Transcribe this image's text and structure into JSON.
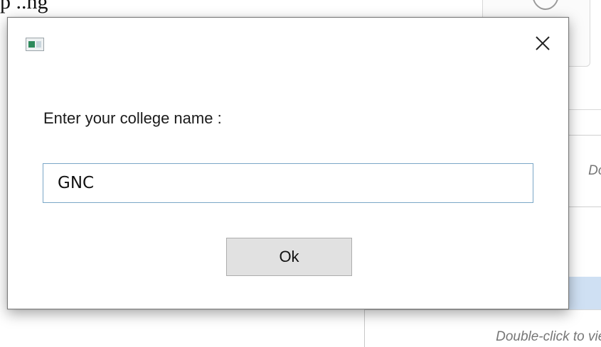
{
  "background": {
    "heading_fragment": "p   ..ng",
    "panel_text": "Double-click to view",
    "bottom_text": "Double-click to view"
  },
  "dialog": {
    "title": "",
    "app_icon": "window-app-icon",
    "close_icon": "close-icon",
    "prompt_label": "Enter your college name :",
    "input_value": "GNC",
    "ok_label": "Ok"
  },
  "colors": {
    "input_border": "#7aa7c7",
    "button_bg": "#e1e1e1",
    "selection_bg": "#cfe0f3"
  }
}
